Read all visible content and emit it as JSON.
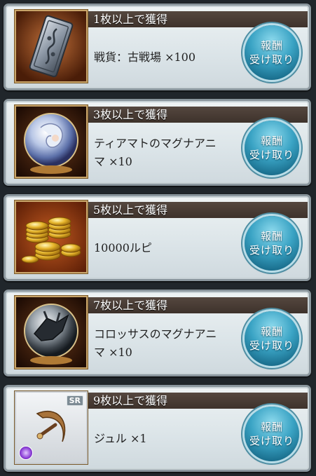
{
  "claim_button": {
    "line1": "報酬",
    "line2": "受け取り"
  },
  "rewards": [
    {
      "header": "1枚以上で獲得",
      "line1": "戦貨：古戦場 ×100",
      "line2": "",
      "icon": "war-coin-card-icon"
    },
    {
      "header": "3枚以上で獲得",
      "line1": "ティアマトのマグナアニ",
      "line2": "マ ×10",
      "icon": "tiamat-anima-orb-icon"
    },
    {
      "header": "5枚以上で獲得",
      "line1": "10000ルピ",
      "line2": "",
      "icon": "rupie-coins-icon"
    },
    {
      "header": "7枚以上で獲得",
      "line1": "コロッサスのマグナアニ",
      "line2": "マ ×10",
      "icon": "colossus-anima-orb-icon"
    },
    {
      "header": "9枚以上で獲得",
      "line1": "ジュル ×1",
      "line2": "",
      "icon": "jur-weapon-icon"
    }
  ],
  "sr_badge": "SR"
}
